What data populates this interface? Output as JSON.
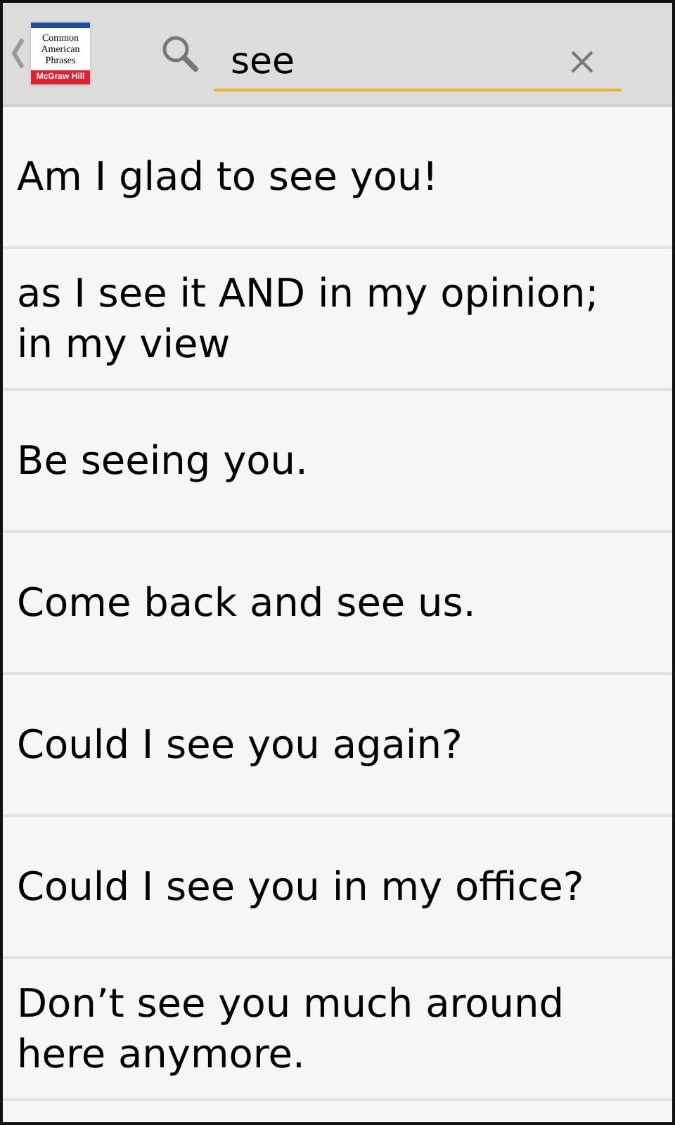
{
  "logo": {
    "title_lines": [
      "Common",
      "American",
      "Phrases"
    ],
    "publisher": "McGraw Hill"
  },
  "search": {
    "value": "see"
  },
  "results": [
    {
      "text": "Am I glad to see you!"
    },
    {
      "text": "as I see it AND in my opinion; in my view"
    },
    {
      "text": "Be seeing you."
    },
    {
      "text": "Come back and see us."
    },
    {
      "text": "Could I see you again?"
    },
    {
      "text": "Could I see you in my office?"
    },
    {
      "text": "Don’t see you much around here anymore."
    }
  ]
}
